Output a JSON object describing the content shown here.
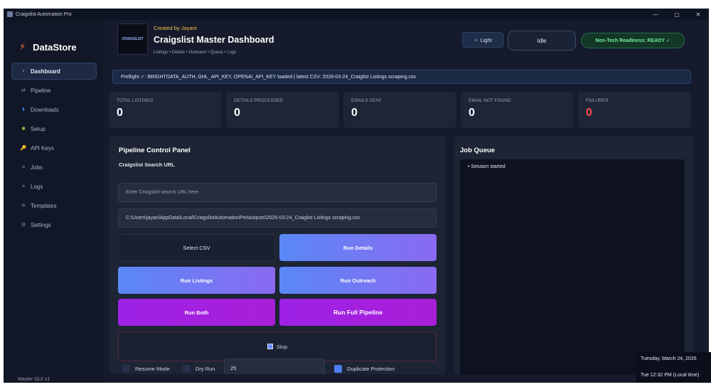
{
  "window": {
    "title": "Craigslist Automation Pro",
    "controls": [
      "—",
      "▢",
      "✕"
    ]
  },
  "sidebar": {
    "brand": "DataStore",
    "brand_icon": "⚡",
    "items": [
      {
        "label": "Dashboard",
        "icon": "•",
        "active": true
      },
      {
        "label": "Pipeline",
        "icon": "⇄"
      },
      {
        "label": "Downloads",
        "icon": "⬇"
      },
      {
        "label": "Setup",
        "icon": "✱"
      },
      {
        "label": "API Keys",
        "icon": "🔑"
      },
      {
        "label": "Jobs",
        "icon": "≡"
      },
      {
        "label": "Logs",
        "icon": "≡"
      },
      {
        "label": "Templates",
        "icon": "≋"
      },
      {
        "label": "Settings",
        "icon": "⚙"
      }
    ],
    "version": "Master GUI v1"
  },
  "header": {
    "logo_text": "CRAIGSLIST",
    "creator": "Created by Jayant",
    "title": "Craigslist Master Dashboard",
    "subtitle": "Listings • Details • Outreach • Queue • Logs",
    "theme_button": "Light",
    "theme_icon": "☼",
    "status": "Idle",
    "readiness": "Non-Tech Readiness: READY ✓"
  },
  "preflight": "Preflight ✓: BRIGHTDATA_AUTH, GHL_API_KEY, OPENAI_API_KEY loaded | latest CSV: 2026-03-24_Craiglist Listings scraping.csv",
  "stats": [
    {
      "label": "TOTAL LISTINGS",
      "value": "0"
    },
    {
      "label": "DETAILS PROCESSED",
      "value": "0"
    },
    {
      "label": "EMAILS SENT",
      "value": "0"
    },
    {
      "label": "EMAIL NOT FOUND",
      "value": "0"
    },
    {
      "label": "FAILURES",
      "value": "0"
    }
  ],
  "pipeline": {
    "title": "Pipeline Control Panel",
    "search_label": "Craigslist Search URL",
    "search_placeholder": "Enter Craigslist search URL here",
    "csv_path": "C:\\Users\\jayan\\AppData\\Local\\CraigslistAutomationPro\\outputs\\2026-03-24_Craiglist Listings scraping.csv",
    "buttons": {
      "select_csv": "Select CSV",
      "run_details": "Run Details",
      "run_listings": "Run Listings",
      "run_outreach": "Run Outreach",
      "run_both": "Run Both",
      "run_full": "Run Full Pipeline",
      "stop": "Stop"
    },
    "options": {
      "resume_mode": "Resume Mode",
      "dry_run": "Dry Run",
      "limit_value": "25",
      "duplicate_protection": "Duplicate Protection"
    }
  },
  "queue": {
    "title": "Job Queue",
    "entries": [
      "• Session started"
    ]
  },
  "clock": {
    "date": "Tuesday, March 24, 2026",
    "time": "Tue 12:32 PM (Local time)"
  }
}
